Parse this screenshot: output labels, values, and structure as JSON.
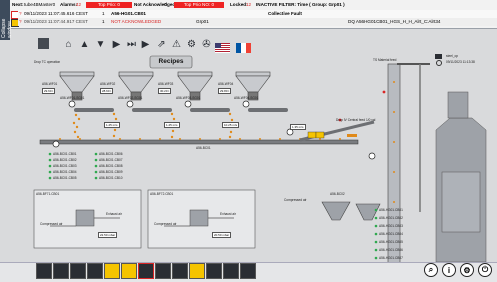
{
  "side_tab": {
    "label": "Collapse window"
  },
  "alarm_header": {
    "next_label": "Next:",
    "next_value": "tube4BMaster0",
    "alarms_label": "Alarms:",
    "alarms_value": "42",
    "top_prio_a": "Top Prio: 0",
    "top_prio_b": "Top Prio NO: 0",
    "not_ack_label": "Not Acknowledged:",
    "not_ack_value": "0",
    "locked_label": "Locked:",
    "locked_value": "12",
    "filter_text": "INACTIVE FILTER: Time ( Group: Grp01 )"
  },
  "alarm_rows": [
    {
      "status": "?",
      "time": "09/11/2023 11:07:45.616 CEST",
      "count": "1",
      "tag": "A56-HG01.CB01",
      "desc": "Collective Fault",
      "group": "",
      "area": ""
    },
    {
      "status": "?",
      "time": "09/11/2023 11:07:44.917 CEST",
      "count": "1",
      "tag": "NOT ACKNOWLEDGED",
      "desc": "",
      "group": "Grp01",
      "area": "DQ  A56HG01CB01_HGS_H_H_Alrt_C:Alrt34"
    }
  ],
  "toolbar": {
    "recipes_label": "Recipes",
    "material_feed_label": "TS Material feed",
    "clock_label": "09/11/2023 11:13:38",
    "user_label": "steel_op"
  },
  "hoppers": [
    {
      "tag": "A56-WF01",
      "weight": "29.60 t"
    },
    {
      "tag": "A56-WF02",
      "weight": "28.60 t"
    },
    {
      "tag": "A56-WF03",
      "weight": "30.20 t"
    },
    {
      "tag": "A56-WF04",
      "weight": "29.80 t"
    }
  ],
  "feeders": [
    {
      "tag": "A56-WF01-SG01",
      "value": "0.00 t/h"
    },
    {
      "tag": "A56-WF02-SG01",
      "value": "0.00 t/h"
    },
    {
      "tag": "A56-WF03-SG01",
      "value": "0.00 t/h"
    },
    {
      "tag": "A56-WF04-SG01",
      "value": "0.00 t/h"
    }
  ],
  "belt_values": [
    "1.25 m/s",
    "1.25 m/s",
    "10.25 m/s",
    "1.35 m/s"
  ],
  "conveyor_tag": "A56-BC01",
  "drop_zone": {
    "title": "Drop TC operation"
  },
  "left_status_list": [
    "A56-BC01.CB01",
    "A56-BC01.CB02",
    "A56-BC01.CB03",
    "A56-BC01.CB04",
    "A56-BC01.CB05"
  ],
  "mid_status_list": [
    "A56-BC01.CB06",
    "A56-BC01.CB07",
    "A56-BC01.CB08",
    "A56-BC01.CB09",
    "A56-BC01.CB10"
  ],
  "compressors": [
    {
      "tag": "A56-BF71.CB01",
      "label": "Compressed air",
      "exhaust": "Exhaust air",
      "value": "22.50 mbar"
    },
    {
      "tag": "A56-BF72.CB01",
      "label": "Compressed air",
      "exhaust": "Exhaust air",
      "value": "20.50 mbar"
    }
  ],
  "right_compressor": {
    "label": "Compressed air",
    "tag": "A56-BC02"
  },
  "right_list": [
    "A56-HG01.CB01",
    "A56-HG01.CB02",
    "A56-HG01.CB03",
    "A56-HG01.CB04",
    "A56-HG01.CB05",
    "A56-HG01.CB06",
    "A56-HG01.CB07"
  ],
  "drop_label": "Drop IV Central feed 1/0 val",
  "footer_right_icons": [
    "search-icon",
    "info-icon",
    "settings-icon",
    "power-icon"
  ],
  "colors": {
    "accent_red": "#d92626",
    "accent_yellow": "#f5c400",
    "panel_bg": "#d9dadc"
  }
}
